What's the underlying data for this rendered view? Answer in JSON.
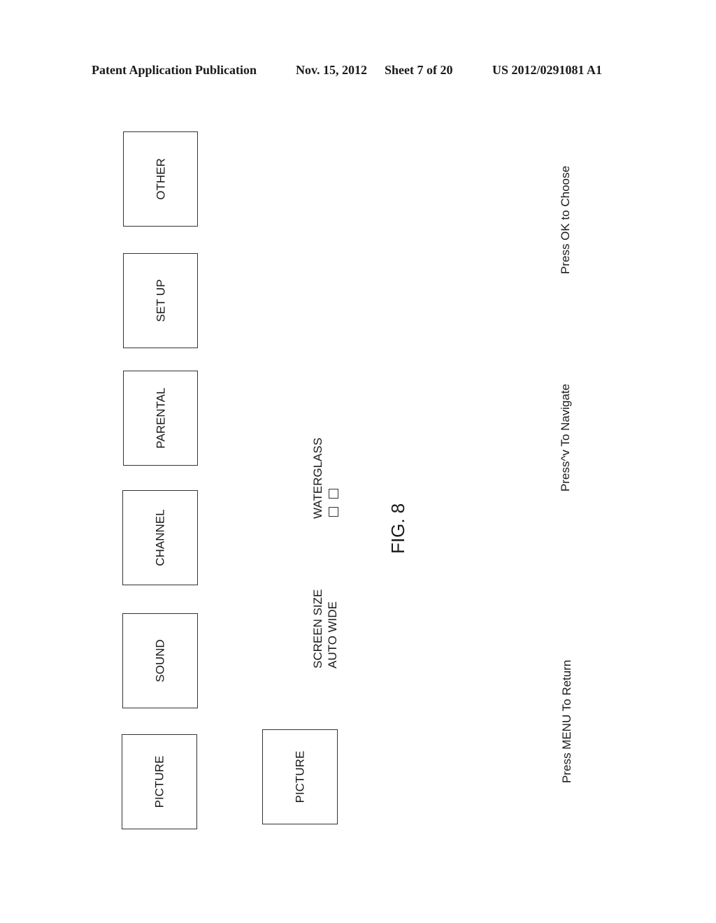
{
  "header": {
    "publication": "Patent Application Publication",
    "date": "Nov. 15, 2012",
    "sheet": "Sheet 7 of 20",
    "number": "US 2012/0291081 A1"
  },
  "menu": {
    "tabs": [
      {
        "label": "OTHER"
      },
      {
        "label": "SET UP"
      },
      {
        "label": "PARENTAL"
      },
      {
        "label": "CHANNEL"
      },
      {
        "label": "SOUND"
      },
      {
        "label": "PICTURE"
      }
    ]
  },
  "submenu": {
    "selected_label": "PICTURE",
    "screen_size_label": "SCREEN SIZE",
    "screen_size_value": "AUTO WIDE",
    "waterglass_label": "WATERGLASS"
  },
  "figure_label": "FIG. 8",
  "hints": {
    "choose": "Press OK to Choose",
    "navigate": "Press^v To Navigate",
    "return": "Press MENU To Return"
  }
}
